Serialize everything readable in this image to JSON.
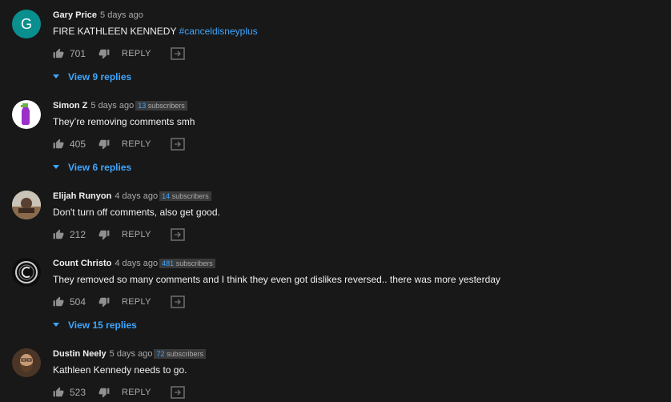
{
  "colors": {
    "background": "#181818",
    "text": "#f1f1f1",
    "muted": "#aaaaaa",
    "link": "#3ea6ff",
    "badge_bg": "#3a3a3a",
    "avatar_g": "#0a8f8f"
  },
  "comments": [
    {
      "avatar_letter": "G",
      "avatar_icon": "letter-avatar",
      "author": "Gary Price",
      "time": "5 days ago",
      "text": "FIRE KATHLEEN KENNEDY ",
      "hashtag": "#canceldisneyplus",
      "likes": "701",
      "reply_label": "REPLY",
      "view_replies": "View 9 replies"
    },
    {
      "avatar_icon": "spray-bottle-avatar",
      "author": "Simon Z",
      "time": "5 days ago",
      "subs_count": "13",
      "subs_word": "subscribers",
      "text": "They’re removing comments smh",
      "likes": "405",
      "reply_label": "REPLY",
      "view_replies": "View 6 replies"
    },
    {
      "avatar_icon": "photo-avatar",
      "author": "Elijah Runyon",
      "time": "4 days ago",
      "subs_count": "14",
      "subs_word": "subscribers",
      "text": "Don't turn off comments, also get good.",
      "likes": "212",
      "reply_label": "REPLY"
    },
    {
      "avatar_icon": "emblem-avatar",
      "author": "Count Christo",
      "time": "4 days ago",
      "subs_count": "481",
      "subs_word": "subscribers",
      "text": "They removed so many comments and I think they even got dislikes reversed.. there was more yesterday",
      "likes": "504",
      "reply_label": "REPLY",
      "view_replies": "View 15 replies"
    },
    {
      "avatar_icon": "bearded-man-avatar",
      "author": "Dustin Neely",
      "time": "5 days ago",
      "subs_count": "72",
      "subs_word": "subscribers",
      "text": "Kathleen Kennedy needs to go.",
      "likes": "523",
      "reply_label": "REPLY"
    }
  ]
}
